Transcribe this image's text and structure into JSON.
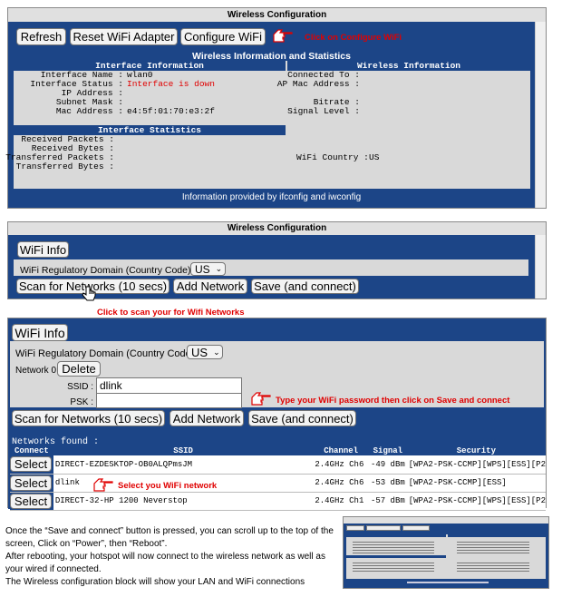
{
  "panel1": {
    "title": "Wireless Configuration",
    "buttons": {
      "refresh": "Refresh",
      "reset": "Reset WiFi Adapter",
      "configure": "Configure WiFi"
    },
    "hint": "Click on Configure WiFi",
    "stats_title": "Wireless Information and Statistics",
    "iface_header": "Interface Information",
    "wireless_header": "Wireless Information",
    "iface_rows": [
      {
        "k": "Interface Name :",
        "v": "wlan0"
      },
      {
        "k": "Interface Status :",
        "v": "Interface is down"
      },
      {
        "k": "IP Address :",
        "v": ""
      },
      {
        "k": "Subnet Mask :",
        "v": ""
      },
      {
        "k": "Mac Address :",
        "v": "e4:5f:01:70:e3:2f"
      }
    ],
    "wireless_rows": [
      {
        "k": "Connected To :",
        "v": ""
      },
      {
        "k": "AP Mac Address :",
        "v": ""
      },
      {
        "k": "",
        "v": ""
      },
      {
        "k": "Bitrate :",
        "v": ""
      },
      {
        "k": "Signal Level :",
        "v": ""
      }
    ],
    "stats_header": "Interface Statistics",
    "stats_rows": [
      {
        "k": "Received Packets :",
        "v": ""
      },
      {
        "k": "Received Bytes :",
        "v": ""
      },
      {
        "k": "Transferred Packets :",
        "v": ""
      },
      {
        "k": "Transferred Bytes :",
        "v": ""
      }
    ],
    "country": {
      "k": "WiFi Country :",
      "v": "US"
    },
    "footer": "Information provided by ifconfig and iwconfig"
  },
  "panel2": {
    "title": "Wireless Configuration",
    "tab": "WiFi Info",
    "regdomain_label": "WiFi Regulatory Domain (Country Code) :",
    "regdomain_value": "US",
    "scan": "Scan for Networks (10 secs)",
    "add": "Add Network",
    "save": "Save (and connect)",
    "hint": "Click to scan your for Wifi Networks"
  },
  "panel3": {
    "tab": "WiFi Info",
    "regdomain_label": "WiFi Regulatory Domain (Country Code) :",
    "regdomain_value": "US",
    "network_label": "Network 0",
    "delete": "Delete",
    "ssid_label": "SSID :",
    "ssid_value": "dlink",
    "psk_label": "PSK :",
    "psk_value": "",
    "psk_hint": "Type your WiFi password then click on Save and connect",
    "scan": "Scan for Networks (10 secs)",
    "add": "Add Network",
    "save": "Save (and connect)",
    "found": "Networks found :",
    "columns": [
      "Connect",
      "SSID",
      "Channel",
      "Signal",
      "Security"
    ],
    "select_label": "Select",
    "rows": [
      {
        "ssid": "DIRECT-EZDESKTOP-OB0ALQPmsJM",
        "channel": "2.4GHz Ch6",
        "signal": "-49 dBm",
        "security": "[WPA2-PSK-CCMP][WPS][ESS][P2"
      },
      {
        "ssid": "dlink",
        "channel": "2.4GHz Ch6",
        "signal": "-53 dBm",
        "security": "[WPA2-PSK-CCMP][ESS]"
      },
      {
        "ssid": "DIRECT-32-HP 1200 Neverstop",
        "channel": "2.4GHz Ch1",
        "signal": "-57 dBm",
        "security": "[WPA2-PSK-CCMP][WPS][ESS][P2"
      }
    ],
    "select_hint": "Select you WiFi network"
  },
  "instructions": [
    "Once the “Save and connect” button is pressed, you can scroll up to the top of the",
    "screen, Click on “Power”, then “Reboot”.",
    "After rebooting, your hotspot will now connect to the wireless network as well as",
    "your wired if connected.",
    "The Wireless configuration block will show your LAN and WiFi connections"
  ],
  "colors": {
    "accent_blue": "#1c4587",
    "hint_red": "#e00000"
  }
}
